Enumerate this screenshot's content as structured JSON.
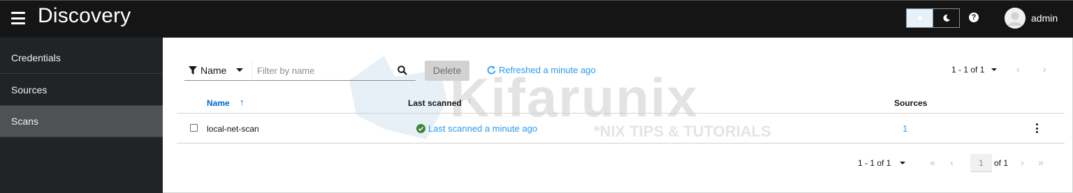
{
  "header": {
    "title": "Discovery",
    "username": "admin"
  },
  "sidebar": {
    "items": [
      {
        "label": "Credentials"
      },
      {
        "label": "Sources"
      },
      {
        "label": "Scans"
      }
    ],
    "active": "Scans"
  },
  "toolbar": {
    "filter_attribute": "Name",
    "filter_placeholder": "Filter by name",
    "delete_label": "Delete",
    "refresh_label": "Refreshed a minute ago",
    "pagination_label": "1 - 1 of 1"
  },
  "table": {
    "columns": [
      "Name",
      "Last scanned",
      "Sources"
    ],
    "rows": [
      {
        "name": "local-net-scan",
        "last_scanned": "Last scanned a minute ago",
        "sources": "1"
      }
    ]
  },
  "footer_pagination": {
    "range_label": "1 - 1 of 1",
    "current_page": "1",
    "of_pages": "of 1"
  },
  "watermark": {
    "brand": "Kifarunix",
    "tagline": "*NIX TIPS & TUTORIALS"
  },
  "colors": {
    "topbar": "#151515",
    "sidebar": "#212427",
    "sidebar_active": "#4f5255",
    "link": "#2b9af3",
    "success": "#3e8635",
    "sort_active": "#0066cc"
  }
}
